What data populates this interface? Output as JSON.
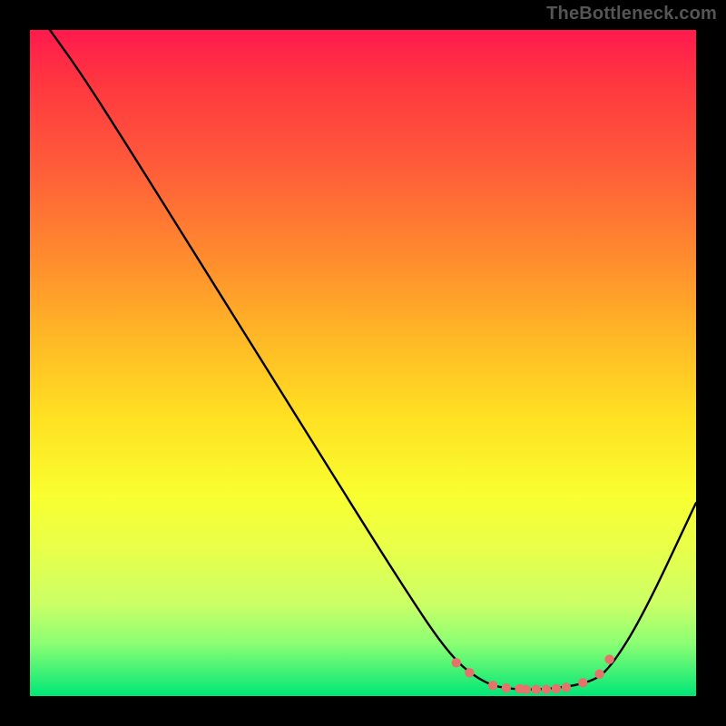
{
  "watermark": "TheBottleneck.com",
  "chart_data": {
    "type": "line",
    "title": "",
    "xlabel": "",
    "ylabel": "",
    "xlim": [
      0,
      1
    ],
    "ylim": [
      0,
      1
    ],
    "series": [
      {
        "name": "curve",
        "x": [
          0.03,
          0.08,
          0.15,
          0.25,
          0.4,
          0.55,
          0.63,
          0.68,
          0.72,
          0.78,
          0.84,
          0.87,
          0.92,
          1.0
        ],
        "y": [
          1.0,
          0.93,
          0.82,
          0.66,
          0.42,
          0.18,
          0.06,
          0.02,
          0.01,
          0.01,
          0.02,
          0.04,
          0.12,
          0.29
        ]
      }
    ],
    "markers": {
      "name": "trough-dots",
      "color": "#e5736c",
      "x": [
        0.64,
        0.66,
        0.695,
        0.715,
        0.735,
        0.745,
        0.76,
        0.775,
        0.79,
        0.805,
        0.83,
        0.855,
        0.87
      ],
      "y": [
        0.05,
        0.035,
        0.016,
        0.012,
        0.011,
        0.01,
        0.01,
        0.01,
        0.011,
        0.013,
        0.02,
        0.033,
        0.055
      ]
    },
    "background": {
      "gradient": "rainbow-red-to-green-vertical"
    }
  }
}
